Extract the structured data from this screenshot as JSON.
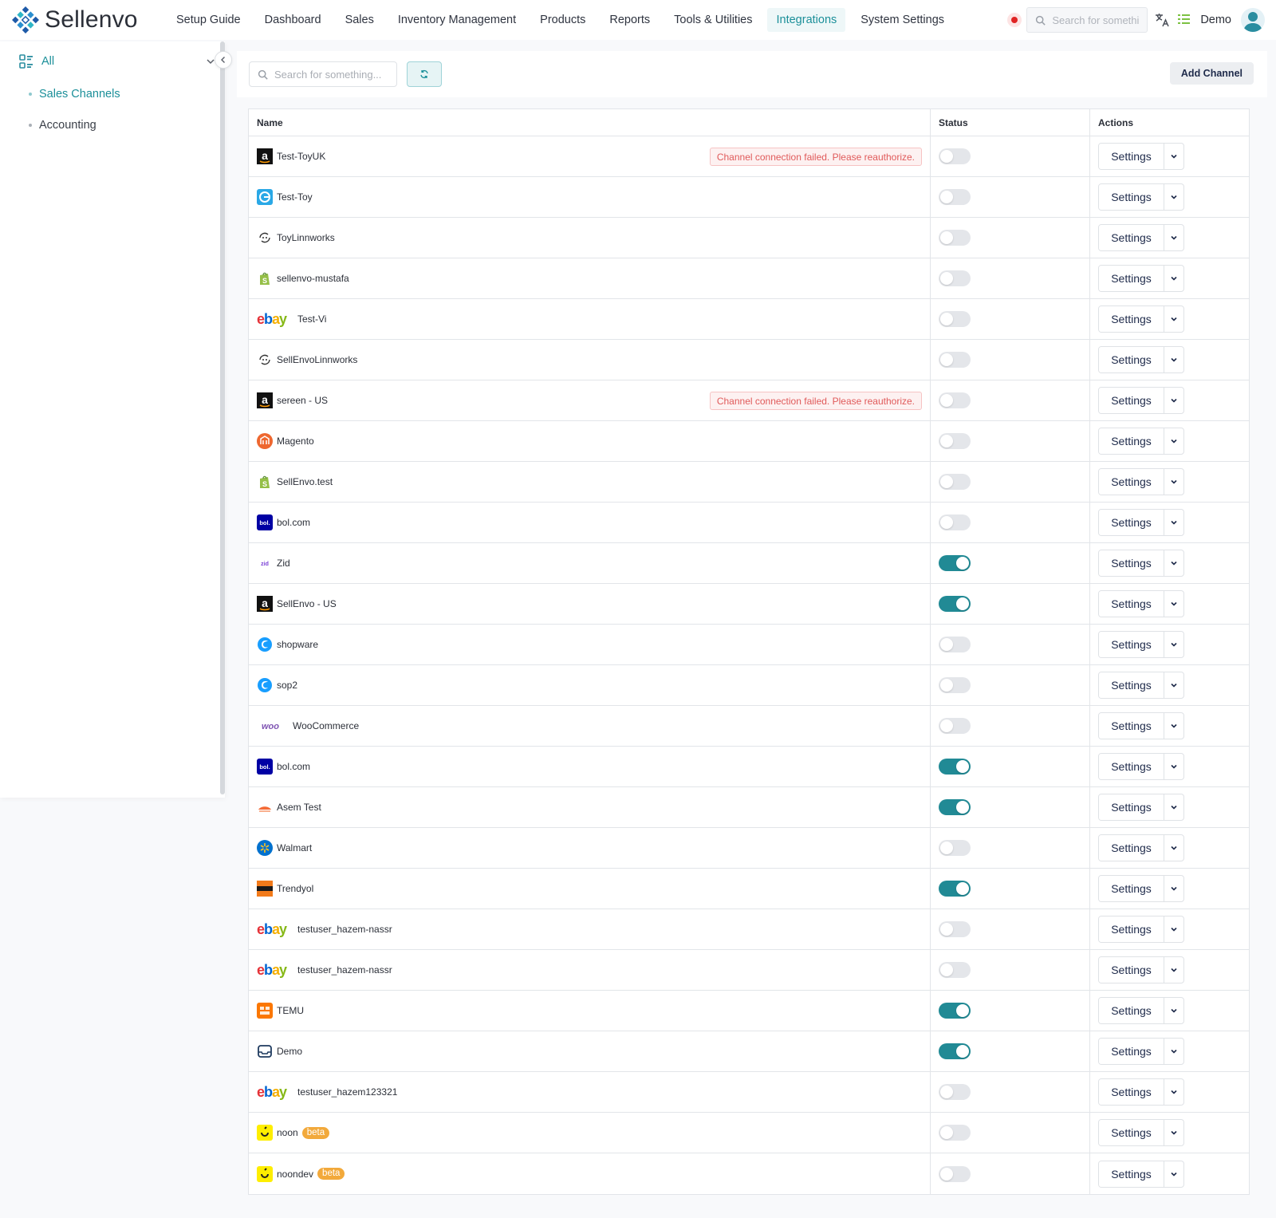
{
  "brand": {
    "name": "Sellenvo"
  },
  "nav": {
    "items": [
      {
        "label": "Setup Guide",
        "active": false
      },
      {
        "label": "Dashboard",
        "active": false
      },
      {
        "label": "Sales",
        "active": false
      },
      {
        "label": "Inventory Management",
        "active": false
      },
      {
        "label": "Products",
        "active": false
      },
      {
        "label": "Reports",
        "active": false
      },
      {
        "label": "Tools & Utilities",
        "active": false
      },
      {
        "label": "Integrations",
        "active": true
      },
      {
        "label": "System Settings",
        "active": false
      }
    ],
    "search_placeholder": "Search for something...",
    "user_label": "Demo"
  },
  "sidebar": {
    "all_label": "All",
    "items": [
      {
        "label": "Sales Channels",
        "active": true
      },
      {
        "label": "Accounting",
        "active": false
      }
    ]
  },
  "toolbar": {
    "search_placeholder": "Search for something...",
    "add_channel_label": "Add Channel"
  },
  "table": {
    "headers": {
      "name": "Name",
      "status": "Status",
      "actions": "Actions"
    },
    "settings_label": "Settings",
    "rows": [
      {
        "name": "Test-ToyUK",
        "logo": "amazon",
        "enabled": false,
        "error": "Channel connection failed. Please reauthorize."
      },
      {
        "name": "Test-Toy",
        "logo": "edge-blue",
        "enabled": false
      },
      {
        "name": "ToyLinnworks",
        "logo": "linnworks",
        "enabled": false
      },
      {
        "name": "sellenvo-mustafa",
        "logo": "shopify",
        "enabled": false
      },
      {
        "name": "Test-Vi",
        "logo": "ebay",
        "enabled": false
      },
      {
        "name": "SellEnvoLinnworks",
        "logo": "linnworks",
        "enabled": false
      },
      {
        "name": "sereen - US",
        "logo": "amazon",
        "enabled": false,
        "error": "Channel connection failed. Please reauthorize."
      },
      {
        "name": "Magento",
        "logo": "magento",
        "enabled": false
      },
      {
        "name": "SellEnvo.test",
        "logo": "shopify",
        "enabled": false
      },
      {
        "name": "bol.com",
        "logo": "bol",
        "enabled": false
      },
      {
        "name": "Zid",
        "logo": "zid",
        "enabled": true
      },
      {
        "name": "SellEnvo - US",
        "logo": "amazon",
        "enabled": true
      },
      {
        "name": "shopware",
        "logo": "shopware",
        "enabled": false
      },
      {
        "name": "sop2",
        "logo": "shopware",
        "enabled": false
      },
      {
        "name": "WooCommerce",
        "logo": "woo",
        "enabled": false
      },
      {
        "name": "bol.com",
        "logo": "bol",
        "enabled": true
      },
      {
        "name": "Asem Test",
        "logo": "salla",
        "enabled": true
      },
      {
        "name": "Walmart",
        "logo": "walmart",
        "enabled": false
      },
      {
        "name": "Trendyol",
        "logo": "trendyol",
        "enabled": true
      },
      {
        "name": "testuser_hazem-nassr",
        "logo": "ebay",
        "enabled": false
      },
      {
        "name": "testuser_hazem-nassr",
        "logo": "ebay",
        "enabled": false
      },
      {
        "name": "TEMU",
        "logo": "temu",
        "enabled": true
      },
      {
        "name": "Demo",
        "logo": "demo",
        "enabled": true
      },
      {
        "name": "testuser_hazem123321",
        "logo": "ebay",
        "enabled": false
      },
      {
        "name": "noon",
        "logo": "noon",
        "enabled": false,
        "badge": "beta"
      },
      {
        "name": "noondev",
        "logo": "noon",
        "enabled": false,
        "badge": "beta"
      }
    ]
  },
  "colors": {
    "accent": "#1b8f99",
    "toggle_on": "#218a95",
    "error_text": "#e05a5a",
    "beta_badge": "#f2a93b"
  }
}
